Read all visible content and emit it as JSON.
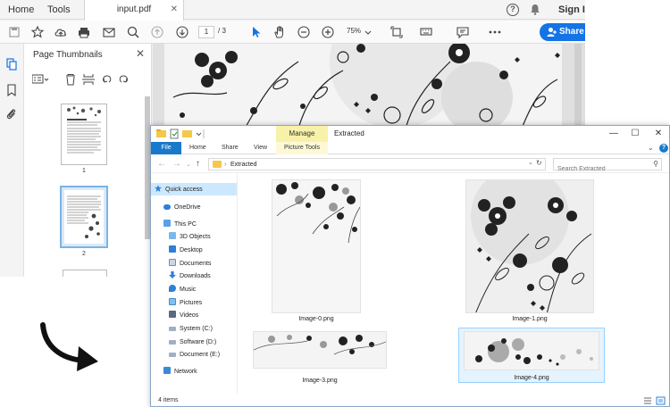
{
  "acrobat": {
    "tabs": {
      "home": "Home",
      "tools": "Tools"
    },
    "document_tab": "input.pdf",
    "sign_in": "Sign I",
    "toolbar": {
      "current_page": "1",
      "total_pages": "/ 3",
      "zoom": "75%",
      "share_label": "Share"
    },
    "thumbnails_panel": {
      "title": "Page Thumbnails",
      "page_numbers": [
        "1",
        "2"
      ]
    }
  },
  "explorer": {
    "window_title": "Extracted",
    "ribbon": {
      "manage": "Manage",
      "file": "File",
      "home": "Home",
      "share": "Share",
      "view": "View",
      "picture_tools": "Picture Tools"
    },
    "address": {
      "folder": "Extracted",
      "search_placeholder": "Search Extracted"
    },
    "nav": {
      "quick_access": "Quick access",
      "onedrive": "OneDrive",
      "this_pc": "This PC",
      "objects_3d": "3D Objects",
      "desktop": "Desktop",
      "documents": "Documents",
      "downloads": "Downloads",
      "music": "Music",
      "pictures": "Pictures",
      "videos": "Videos",
      "system_c": "System (C:)",
      "software_d": "Software (D:)",
      "document_e": "Document (E:)",
      "network": "Network"
    },
    "files": [
      "Image-0.png",
      "Image-1.png",
      "Image-3.png",
      "Image-4.png"
    ],
    "status": "4 items"
  },
  "colors": {
    "accent_blue": "#1473e6",
    "file_tab_blue": "#1979ca",
    "manage_yellow": "#f8f1a9",
    "selection_blue": "#cce8ff"
  }
}
